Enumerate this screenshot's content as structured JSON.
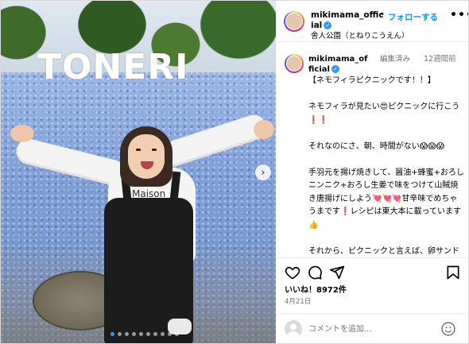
{
  "post": {
    "sign_text": "TONERI",
    "shirt_text": "Maison",
    "carousel": {
      "total": 10,
      "active": 0
    }
  },
  "header": {
    "username": "mikimama_official",
    "follow_label": "フォローする",
    "separator": "•",
    "location": "舎人公園（とねりこうえん）",
    "more": "•••"
  },
  "caption": {
    "username": "mikimama_official",
    "edited": "編集済み",
    "time": "12週間前",
    "text": "【ネモフィラピクニックです！！】\n\nネモフィラが見たい😍ピクニックに行こう❗❗\n\nそれなのにさ、朝、時間がない😱😱😱\n\n手羽元を揚げ焼きして、醤油+蜂蜜+おろしニンニク+おろし生姜で味をつけて山賊焼き唐揚げにしよう💘💘💘甘辛味でめちゃうまです❗レシピは東大本に載っています👍\n\nそれから、ピクニックと言えば、卵サンドでしょ❓サラダとキウイヨーグルトも持ってギリギリ間に合った〜🥰"
  },
  "actions": {
    "like_icon": "heart-icon",
    "comment_icon": "comment-icon",
    "share_icon": "share-icon",
    "save_icon": "bookmark-icon"
  },
  "likes_text": "いいね！8972件",
  "date_text": "4月21日",
  "comment_box": {
    "placeholder": "コメントを追加...",
    "emoji_icon": "smiley-icon"
  },
  "colors": {
    "link_blue": "#0095f6",
    "verified_blue": "#3897f0",
    "muted": "#737373"
  }
}
